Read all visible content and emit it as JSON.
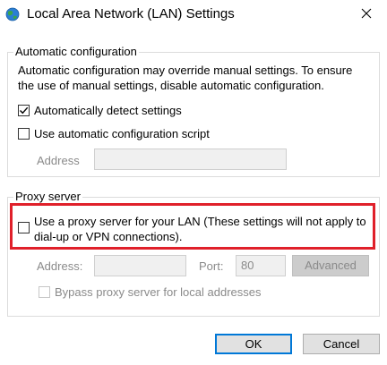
{
  "window": {
    "title": "Local Area Network (LAN) Settings",
    "icon": "network-globe-icon",
    "close_icon": "close-icon"
  },
  "auto_config": {
    "group_label": "Automatic configuration",
    "description_line1": "Automatic configuration may override manual settings.  To ensure",
    "description_line2": "the use of manual settings, disable automatic configuration.",
    "detect_settings_label": "Automatically detect settings",
    "detect_settings_checked": true,
    "script_label": "Use automatic configuration script",
    "script_checked": false,
    "address_label": "Address",
    "address_value": ""
  },
  "proxy": {
    "group_label": "Proxy server",
    "use_proxy_line1": "Use a proxy server for your LAN (These settings will not apply to",
    "use_proxy_line2": "dial-up or VPN connections).",
    "use_proxy_checked": false,
    "address_label": "Address:",
    "address_value": "",
    "port_label": "Port:",
    "port_value": "80",
    "advanced_label": "Advanced",
    "bypass_label": "Bypass proxy server for local addresses",
    "bypass_checked": false,
    "highlight_color": "#e0202a"
  },
  "buttons": {
    "ok_label": "OK",
    "cancel_label": "Cancel"
  }
}
